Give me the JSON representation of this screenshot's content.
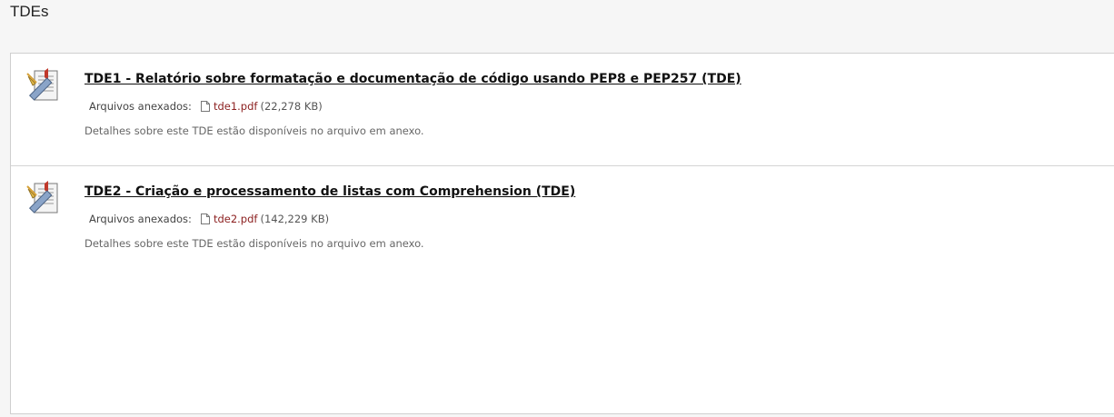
{
  "page": {
    "title": "TDEs"
  },
  "items": [
    {
      "title": "TDE1 - Relatório sobre formatação e documentação de código usando PEP8 e PEP257 (TDE)",
      "attachments_label": "Arquivos anexados:",
      "file_name": "tde1.pdf",
      "file_size": "(22,278 KB)",
      "details": "Detalhes sobre este TDE estão disponíveis no arquivo em anexo.",
      "icon": "assignment-icon"
    },
    {
      "title": "TDE2 - Criação e processamento de listas com Comprehension (TDE)",
      "attachments_label": "Arquivos anexados:",
      "file_name": "tde2.pdf",
      "file_size": "(142,229 KB)",
      "details": "Detalhes sobre este TDE estão disponíveis no arquivo em anexo.",
      "icon": "assignment-icon"
    }
  ],
  "colors": {
    "link": "#8b1e1e",
    "title": "#111111",
    "background": "#f6f6f6"
  }
}
